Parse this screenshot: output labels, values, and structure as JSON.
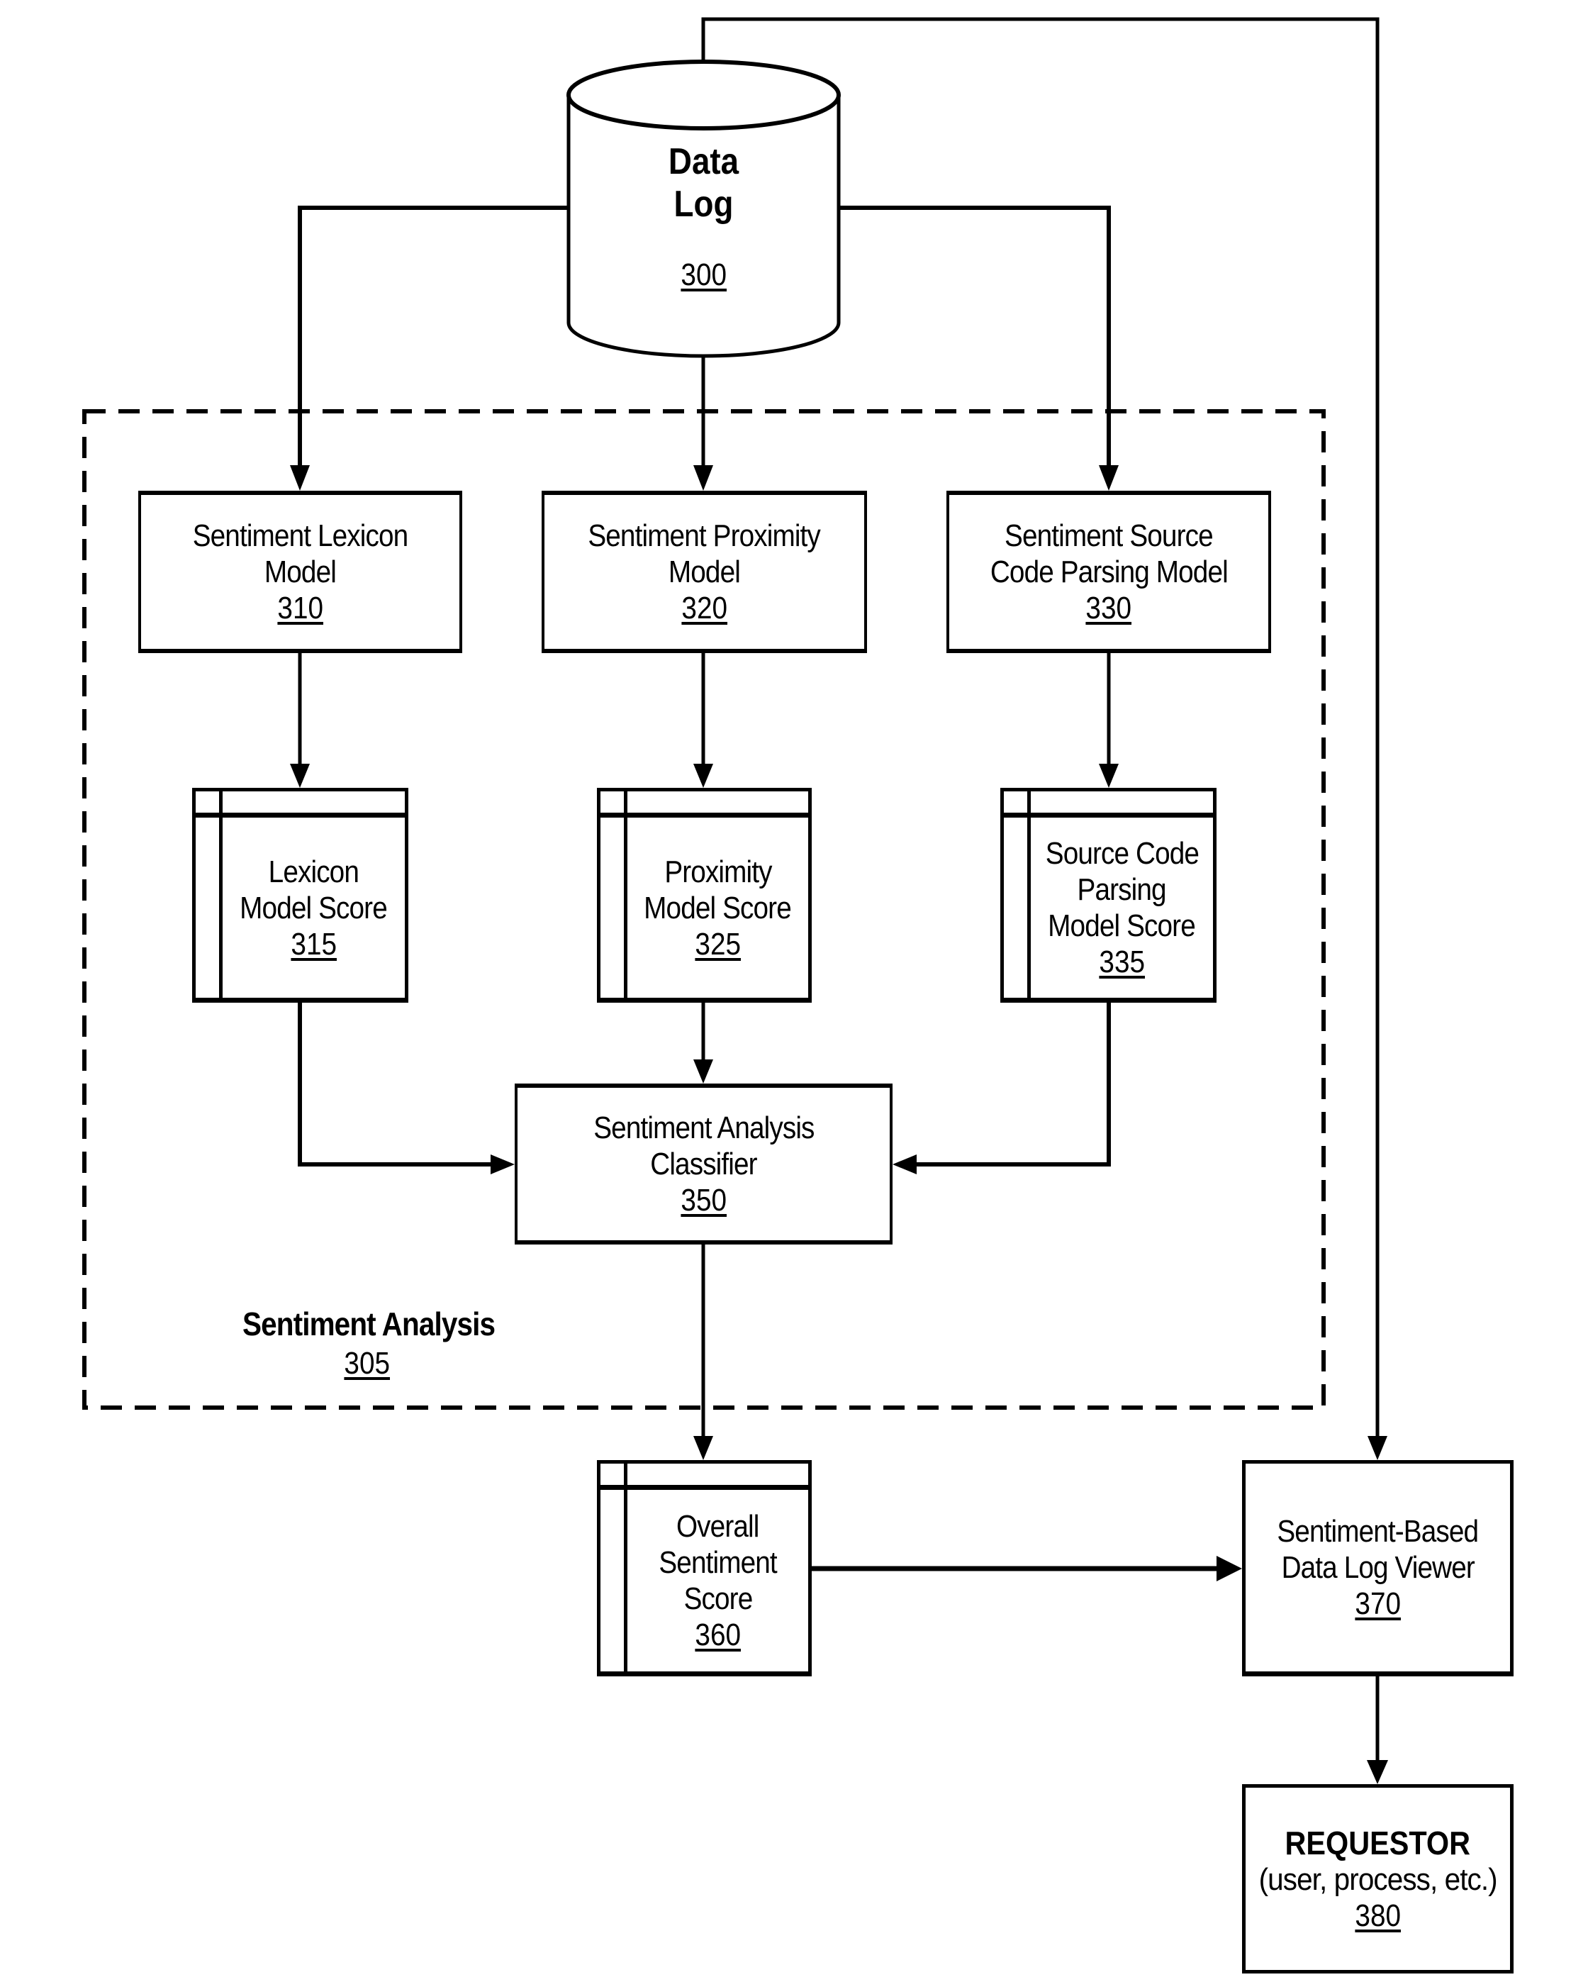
{
  "diagram": {
    "data_log": {
      "title_line1": "Data",
      "title_line2": "Log",
      "ref": "300"
    },
    "group": {
      "label": "Sentiment Analysis",
      "ref": "305"
    },
    "models": [
      {
        "line1": "Sentiment Lexicon",
        "line2": "Model",
        "ref": "310"
      },
      {
        "line1": "Sentiment Proximity",
        "line2": "Model",
        "ref": "320"
      },
      {
        "line1": "Sentiment Source",
        "line2": "Code Parsing Model",
        "ref": "330"
      }
    ],
    "scores": [
      {
        "lines": [
          "Lexicon",
          "Model Score"
        ],
        "ref": "315"
      },
      {
        "lines": [
          "Proximity",
          "Model Score"
        ],
        "ref": "325"
      },
      {
        "lines": [
          "Source Code",
          "Parsing",
          "Model Score"
        ],
        "ref": "335"
      }
    ],
    "classifier": {
      "line1": "Sentiment Analysis",
      "line2": "Classifier",
      "ref": "350"
    },
    "overall_score": {
      "line1": "Overall",
      "line2": "Sentiment",
      "line3": "Score",
      "ref": "360"
    },
    "viewer": {
      "line1": "Sentiment-Based",
      "line2": "Data Log Viewer",
      "ref": "370"
    },
    "requestor": {
      "title": "REQUESTOR",
      "subtitle": "(user, process, etc.)",
      "ref": "380"
    }
  }
}
